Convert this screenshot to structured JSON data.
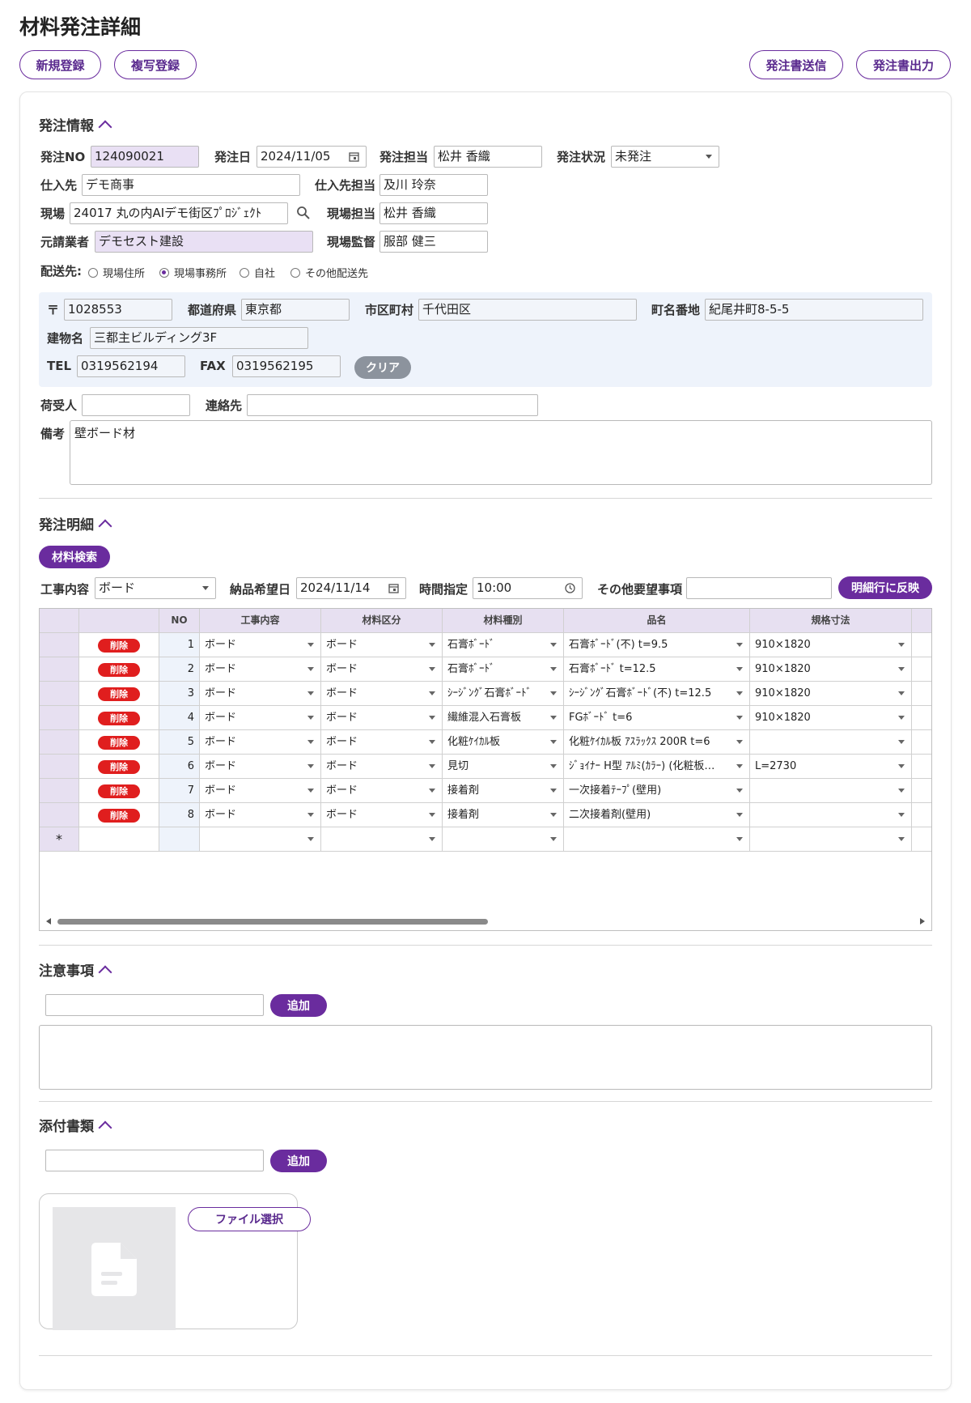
{
  "page": {
    "title": "材料発注詳細"
  },
  "toolbar": {
    "new_label": "新規登録",
    "copy_label": "複写登録",
    "send_label": "発注書送信",
    "print_label": "発注書出力"
  },
  "order_info": {
    "section_title": "発注情報",
    "order_no": {
      "label": "発注NO",
      "value": "124090021"
    },
    "order_date": {
      "label": "発注日",
      "value": "2024/11/05"
    },
    "order_staff": {
      "label": "発注担当",
      "value": "松井 香織"
    },
    "order_status": {
      "label": "発注状況",
      "value": "未発注"
    },
    "supplier": {
      "label": "仕入先",
      "value": "デモ商事"
    },
    "supplier_staff": {
      "label": "仕入先担当",
      "value": "及川 玲奈"
    },
    "site": {
      "label": "現場",
      "value": "24017 丸の内AIデモ街区ﾌﾟﾛｼﾞｪｸﾄ"
    },
    "site_staff": {
      "label": "現場担当",
      "value": "松井 香織"
    },
    "contractor": {
      "label": "元請業者",
      "value": "デモセスト建設"
    },
    "site_supervisor": {
      "label": "現場監督",
      "value": "服部 健三"
    },
    "delivery": {
      "label": "配送先:",
      "options": [
        "現場住所",
        "現場事務所",
        "自社",
        "その他配送先"
      ],
      "selected": "現場事務所"
    },
    "address": {
      "zip_label": "〒",
      "zip": "1028553",
      "pref_label": "都道府県",
      "pref": "東京都",
      "city_label": "市区町村",
      "city": "千代田区",
      "street_label": "町名番地",
      "street": "紀尾井町8-5-5",
      "building_label": "建物名",
      "building": "三都主ビルディング3F",
      "tel_label": "TEL",
      "tel": "0319562194",
      "fax_label": "FAX",
      "fax": "0319562195",
      "clear_label": "クリア"
    },
    "receiver": {
      "label": "荷受人",
      "value": ""
    },
    "contact": {
      "label": "連絡先",
      "value": ""
    },
    "remarks": {
      "label": "備考",
      "value": "壁ボード材"
    }
  },
  "details": {
    "section_title": "発注明細",
    "search_label": "材料検索",
    "work_label": "工事内容",
    "work_value": "ボード",
    "delivery_date_label": "納品希望日",
    "delivery_date": "2024/11/14",
    "time_label": "時間指定",
    "time": "10:00",
    "other_label": "その他要望事項",
    "other_value": "",
    "apply_label": "明細行に反映",
    "columns": [
      "",
      "",
      "NO",
      "工事内容",
      "材料区分",
      "材料種別",
      "品名",
      "規格寸法"
    ],
    "delete_label": "削除",
    "new_row_marker": "*",
    "rows": [
      {
        "no": "1",
        "work": "ボード",
        "category": "ボード",
        "type": "石膏ﾎﾞｰﾄﾞ",
        "name": "石膏ﾎﾞｰﾄﾞ(不) t=9.5",
        "size": "910×1820"
      },
      {
        "no": "2",
        "work": "ボード",
        "category": "ボード",
        "type": "石膏ﾎﾞｰﾄﾞ",
        "name": "石膏ﾎﾞｰﾄﾞ t=12.5",
        "size": "910×1820"
      },
      {
        "no": "3",
        "work": "ボード",
        "category": "ボード",
        "type": "ｼｰｼﾞﾝｸﾞ石膏ﾎﾞｰﾄﾞ",
        "name": "ｼｰｼﾞﾝｸﾞ石膏ﾎﾞｰﾄﾞ(不) t=12.5",
        "size": "910×1820"
      },
      {
        "no": "4",
        "work": "ボード",
        "category": "ボード",
        "type": "繊維混入石膏板",
        "name": "FGﾎﾞｰﾄﾞ t=6",
        "size": "910×1820"
      },
      {
        "no": "5",
        "work": "ボード",
        "category": "ボード",
        "type": "化粧ｹｲｶﾙ板",
        "name": "化粧ｹｲｶﾙ板 ｱｽﾗｯｸｽ 200R t=6",
        "size": ""
      },
      {
        "no": "6",
        "work": "ボード",
        "category": "ボード",
        "type": "見切",
        "name": "ｼﾞｮｲﾅｰ H型 ｱﾙﾐ(ｶﾗｰ) (化粧板…",
        "size": "L=2730"
      },
      {
        "no": "7",
        "work": "ボード",
        "category": "ボード",
        "type": "接着剤",
        "name": "一次接着ﾃｰﾌﾟ(壁用)",
        "size": ""
      },
      {
        "no": "8",
        "work": "ボード",
        "category": "ボード",
        "type": "接着剤",
        "name": "二次接着剤(壁用)",
        "size": ""
      }
    ]
  },
  "notes": {
    "section_title": "注意事項",
    "input_value": "",
    "add_label": "追加",
    "content": ""
  },
  "attachments": {
    "section_title": "添付書類",
    "input_value": "",
    "add_label": "追加",
    "file_select_label": "ファイル選択"
  },
  "colors": {
    "accent": "#6a2c9e",
    "danger": "#e01e1e",
    "header_bg": "#e7e0f1",
    "address_bg": "#eef3fb"
  },
  "icons": [
    "calendar-icon",
    "search-icon",
    "clock-icon",
    "chevron-up-icon",
    "dropdown-caret-icon",
    "document-icon"
  ]
}
